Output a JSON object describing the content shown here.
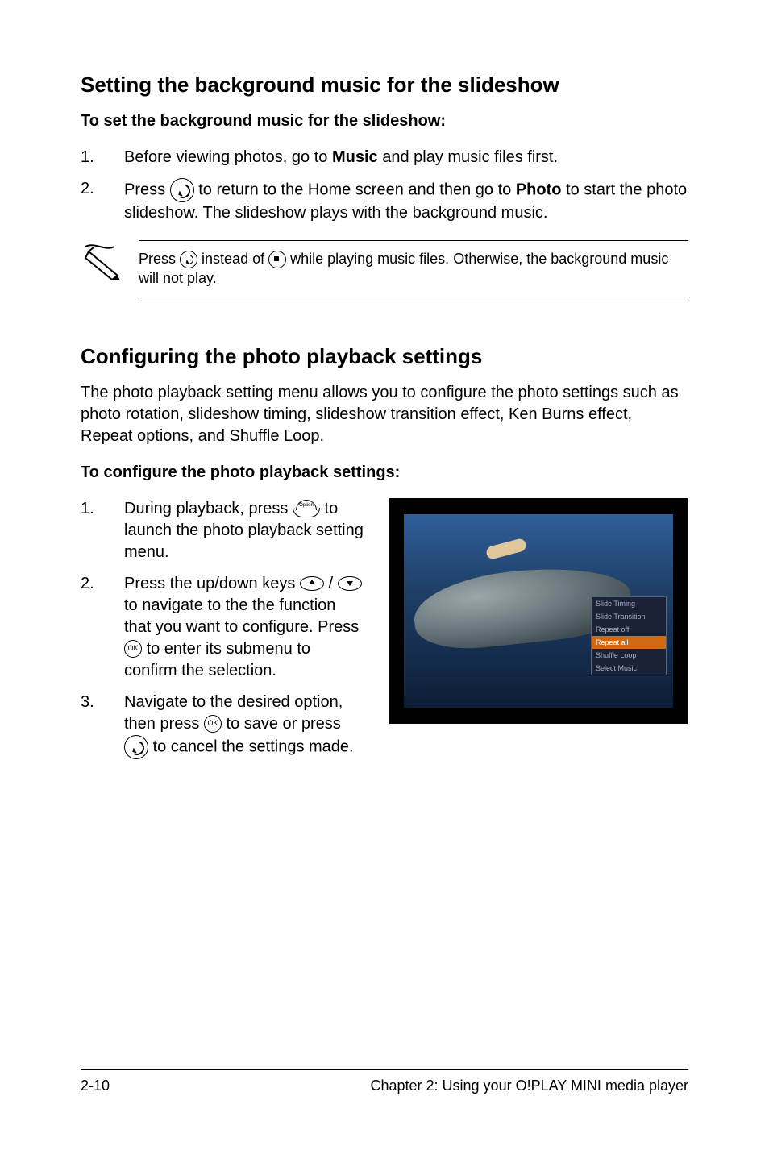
{
  "section1": {
    "heading": "Setting the background music for the slideshow",
    "lead": "To set the background music for the slideshow:",
    "steps": [
      {
        "num": "1.",
        "parts": [
          "Before viewing photos, go to ",
          "Music",
          " and play music files first."
        ]
      },
      {
        "num": "2.",
        "parts_a": [
          "Press "
        ],
        "parts_b": [
          " to return to the Home screen and then go to ",
          "Photo",
          " to start the photo slideshow. The slideshow plays with the background music."
        ]
      }
    ],
    "note_a": "Press ",
    "note_b": " instead of ",
    "note_c": " while playing music files. Otherwise, the background music will not play."
  },
  "section2": {
    "heading": "Configuring the photo playback settings",
    "intro": "The photo playback setting menu allows you to configure the photo settings such as photo rotation, slideshow timing, slideshow transition effect, Ken Burns effect, Repeat options, and Shuffle Loop.",
    "lead": "To configure the photo playback settings:",
    "steps": [
      {
        "num": "1.",
        "a": "During playback, press ",
        "b": " to launch the photo playback setting menu."
      },
      {
        "num": "2.",
        "a": "Press the up/down keys ",
        "b": " / ",
        "c": " to navigate to the the function that you want to configure. Press ",
        "d": " to enter its submenu to confirm the selection."
      },
      {
        "num": "3.",
        "a": "Navigate to the desired option, then press ",
        "b": " to save or press ",
        "c": " to cancel the settings made."
      }
    ]
  },
  "screenshot_menu": {
    "items": [
      "Slide Timing",
      "Slide Transition",
      "Repeat off",
      "Repeat all",
      "Shuffle Loop",
      "Select Music"
    ],
    "highlight_index": 3
  },
  "icons": {
    "ok_label": "OK",
    "option_label": "Option"
  },
  "footer": {
    "left": "2-10",
    "right": "Chapter 2: Using your O!PLAY MINI media player"
  }
}
